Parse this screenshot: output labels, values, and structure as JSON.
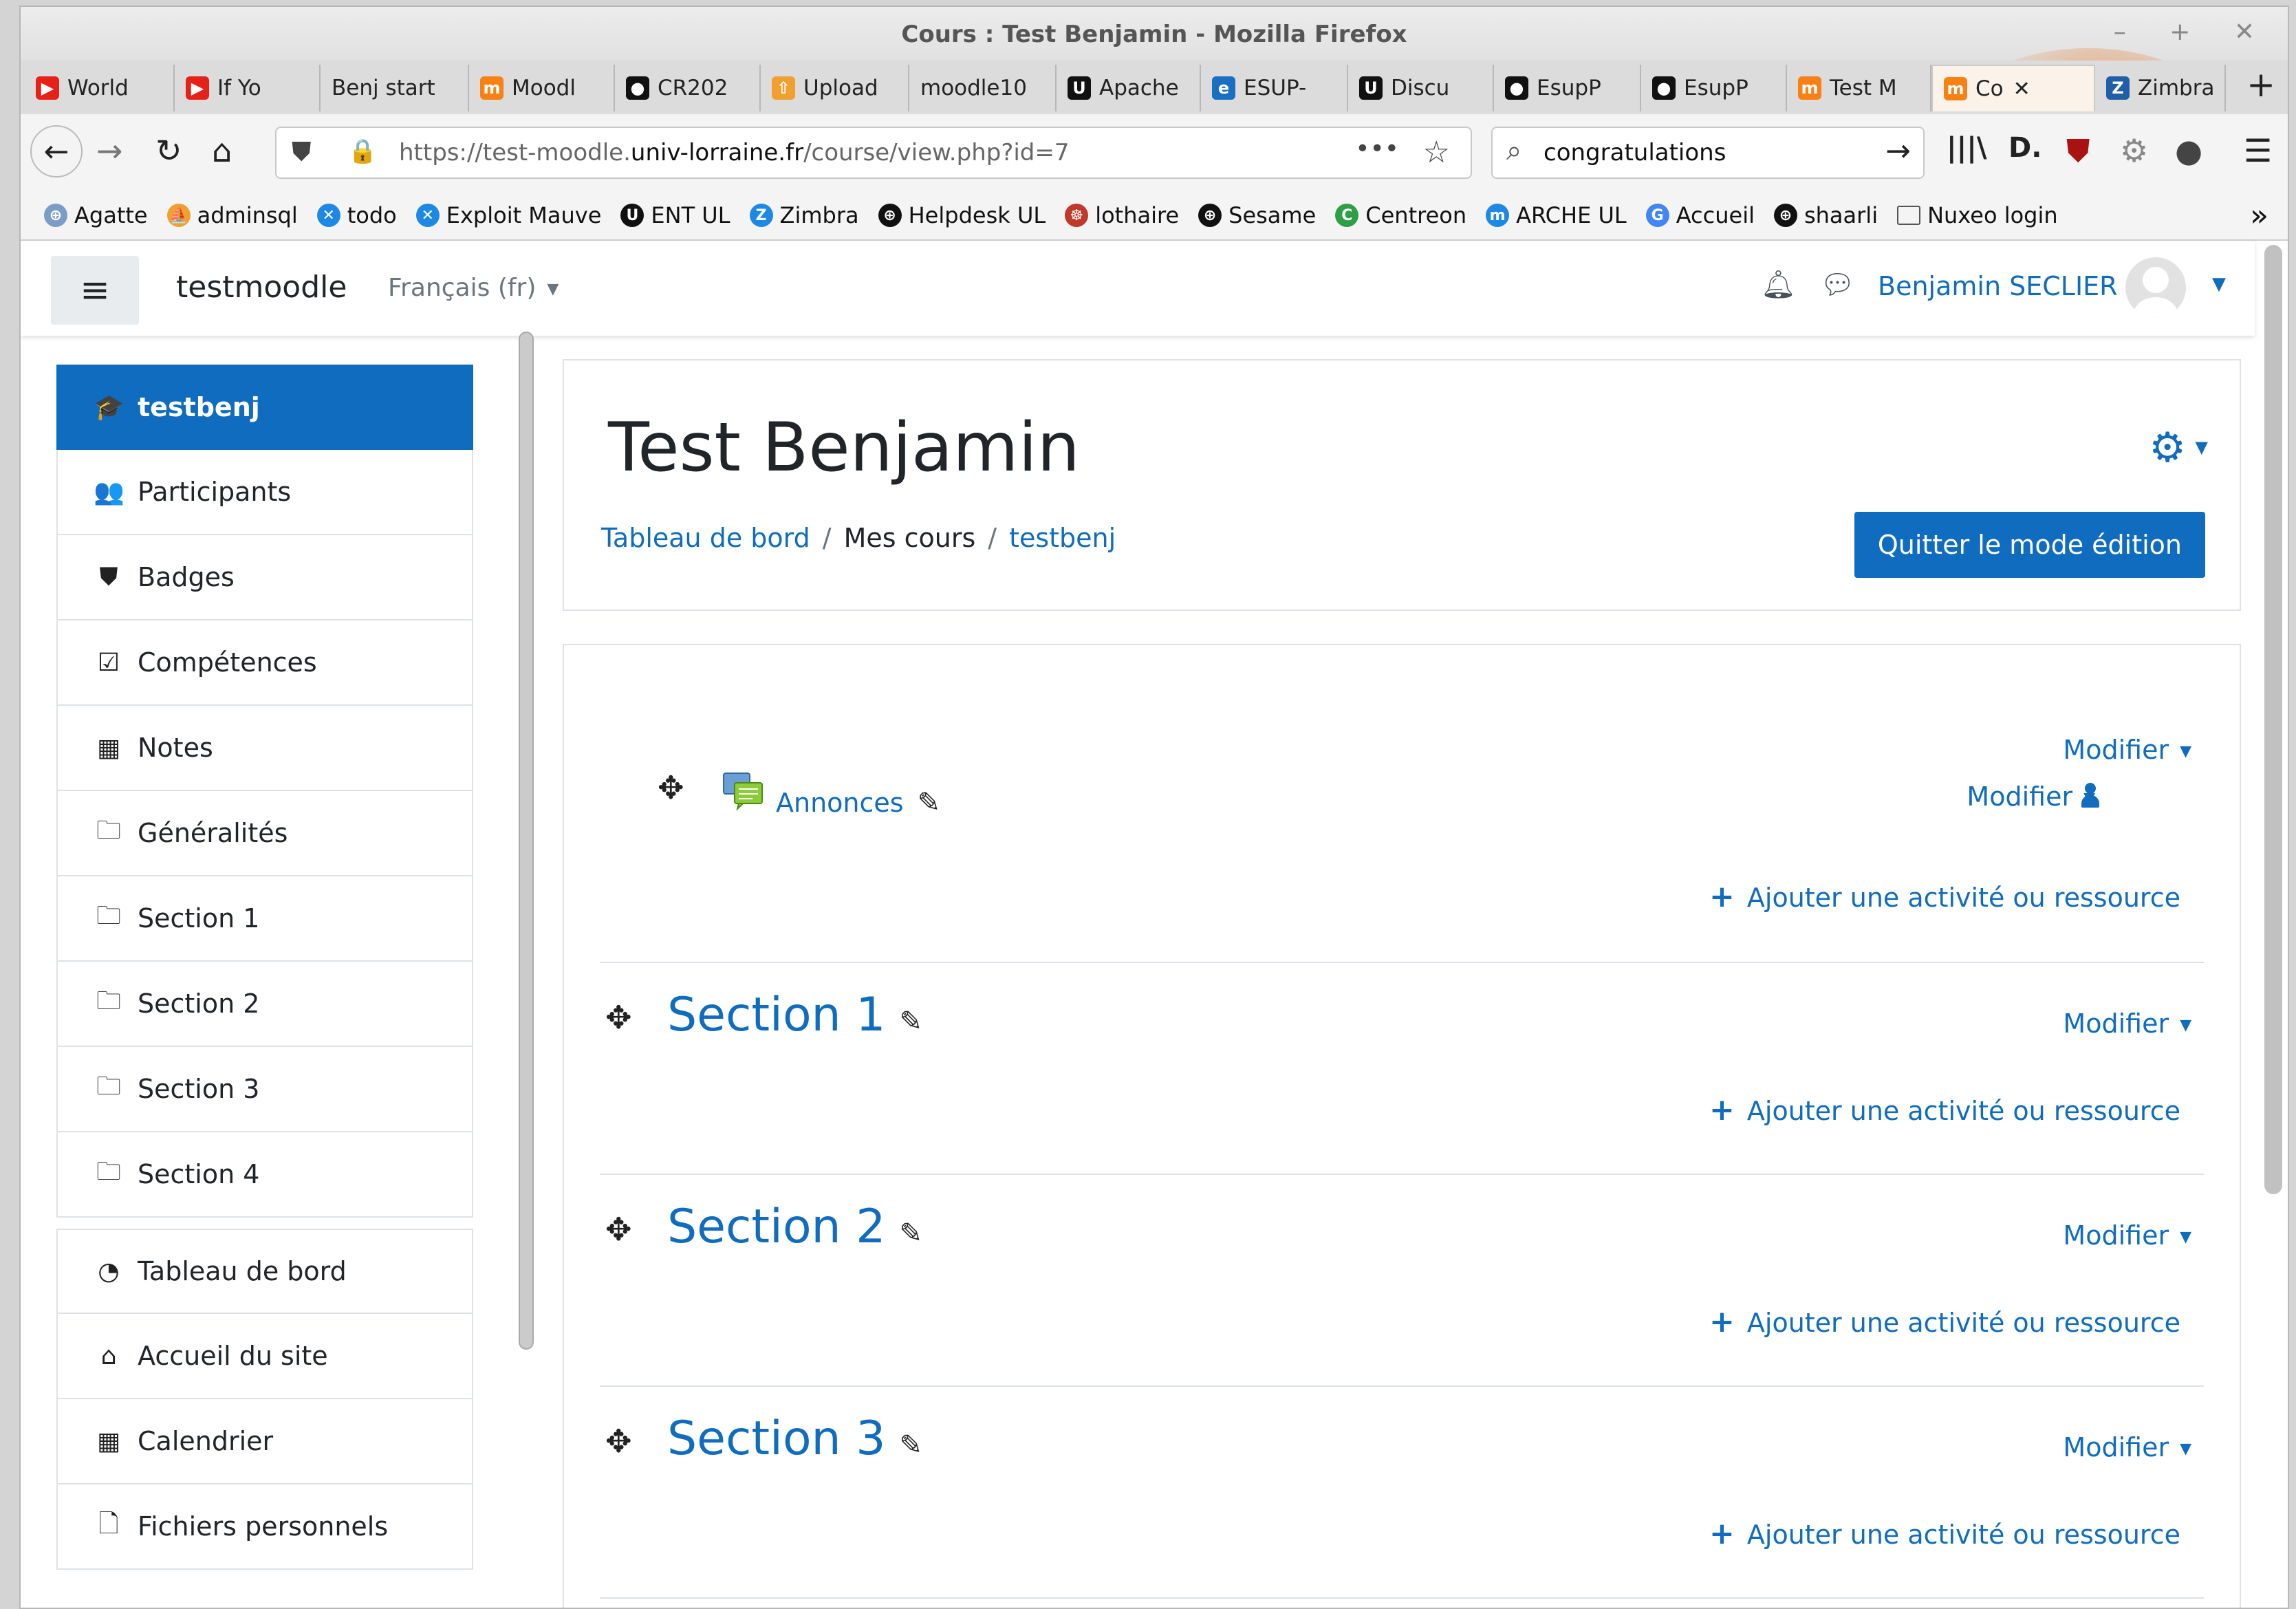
{
  "window": {
    "title": "Cours : Test Benjamin - Mozilla Firefox",
    "controls": "– + ✕"
  },
  "tabs": [
    {
      "label": "World",
      "icon": "youtube-icon",
      "color": "#e62117"
    },
    {
      "label": "If Yo",
      "icon": "youtube-icon",
      "color": "#e62117"
    },
    {
      "label": "Benj start",
      "icon": "",
      "color": ""
    },
    {
      "label": "Moodl",
      "icon": "moodle-icon",
      "color": "#f98012"
    },
    {
      "label": "CR202",
      "icon": "github-icon",
      "color": "#111111"
    },
    {
      "label": "Upload",
      "icon": "upload-icon",
      "color": "#f0a030"
    },
    {
      "label": "moodle10",
      "icon": "",
      "color": ""
    },
    {
      "label": "Apache",
      "icon": "u-icon",
      "color": "#111111"
    },
    {
      "label": "ESUP-",
      "icon": "ep-icon",
      "color": "#1b6fc2"
    },
    {
      "label": "Discu",
      "icon": "u-icon",
      "color": "#111111"
    },
    {
      "label": "EsupP",
      "icon": "github-icon",
      "color": "#111111"
    },
    {
      "label": "EsupP",
      "icon": "github-icon",
      "color": "#111111"
    },
    {
      "label": "Test M",
      "icon": "moodle-icon",
      "color": "#f98012"
    },
    {
      "label": "Co",
      "icon": "moodle-icon",
      "color": "#f98012",
      "active": true
    },
    {
      "label": "Zimbra",
      "icon": "zimbra-icon",
      "color": "#1f5fa8"
    }
  ],
  "navbar": {
    "url_prefix": "https://test-moodle.",
    "url_domain": "univ-lorraine.fr",
    "url_path": "/course/view.php?id=7",
    "search_value": "congratulations"
  },
  "bookmarks": [
    {
      "label": "Agatte",
      "icon": "globe-icon",
      "color": "#7a9cc6"
    },
    {
      "label": "adminsql",
      "icon": "pma-icon",
      "color": "#f0a030"
    },
    {
      "label": "todo",
      "icon": "x-icon",
      "color": "#1e88e5"
    },
    {
      "label": "Exploit Mauve",
      "icon": "x-icon",
      "color": "#1e88e5"
    },
    {
      "label": "ENT UL",
      "icon": "u-icon",
      "color": "#111111"
    },
    {
      "label": "Zimbra",
      "icon": "zimbra-icon",
      "color": "#1e88e5"
    },
    {
      "label": "Helpdesk UL",
      "icon": "globe-icon",
      "color": "#111111"
    },
    {
      "label": "lothaire",
      "icon": "lothaire-icon",
      "color": "#c0392b"
    },
    {
      "label": "Sesame",
      "icon": "globe-icon",
      "color": "#111111"
    },
    {
      "label": "Centreon",
      "icon": "centreon-icon",
      "color": "#2e9e47"
    },
    {
      "label": "ARCHE UL",
      "icon": "moodle-icon",
      "color": "#1e88e5"
    },
    {
      "label": "Accueil",
      "icon": "google-icon",
      "color": "#4285f4"
    },
    {
      "label": "shaarli",
      "icon": "globe-icon",
      "color": "#111111"
    },
    {
      "label": "Nuxeo login",
      "icon": "folder-icon",
      "color": "#555555"
    }
  ],
  "moodle": {
    "site_name": "testmoodle",
    "language": "Français (fr)",
    "user_name": "Benjamin SECLIER"
  },
  "drawer": {
    "course_items": [
      {
        "label": "testbenj",
        "icon": "graduation-cap-icon",
        "glyph": "🎓",
        "active": true
      },
      {
        "label": "Participants",
        "icon": "users-icon",
        "glyph": "👥"
      },
      {
        "label": "Badges",
        "icon": "shield-icon",
        "glyph": "⛊"
      },
      {
        "label": "Compétences",
        "icon": "check-square-icon",
        "glyph": "☑"
      },
      {
        "label": "Notes",
        "icon": "table-icon",
        "glyph": "▦"
      },
      {
        "label": "Généralités",
        "icon": "folder-icon",
        "glyph": "🗀"
      },
      {
        "label": "Section 1",
        "icon": "folder-icon",
        "glyph": "🗀"
      },
      {
        "label": "Section 2",
        "icon": "folder-icon",
        "glyph": "🗀"
      },
      {
        "label": "Section 3",
        "icon": "folder-icon",
        "glyph": "🗀"
      },
      {
        "label": "Section 4",
        "icon": "folder-icon",
        "glyph": "🗀"
      }
    ],
    "site_items": [
      {
        "label": "Tableau de bord",
        "icon": "dashboard-icon",
        "glyph": "◔"
      },
      {
        "label": "Accueil du site",
        "icon": "home-icon",
        "glyph": "⌂"
      },
      {
        "label": "Calendrier",
        "icon": "calendar-icon",
        "glyph": "▦"
      },
      {
        "label": "Fichiers personnels",
        "icon": "file-icon",
        "glyph": "🗋"
      }
    ]
  },
  "header": {
    "course_title": "Test Benjamin",
    "breadcrumb": [
      {
        "label": "Tableau de bord",
        "link": true
      },
      {
        "label": "Mes cours",
        "link": false
      },
      {
        "label": "testbenj",
        "link": true
      }
    ],
    "edit_button": "Quitter le mode édition"
  },
  "content": {
    "modifier_label": "Modifier",
    "add_activity_label": "Ajouter une activité ou ressource",
    "general_activity": "Annonces",
    "sections": [
      "Section 1",
      "Section 2",
      "Section 3"
    ]
  },
  "colors": {
    "moodle_primary": "#0f6cbf",
    "youtube": "#e62117"
  }
}
